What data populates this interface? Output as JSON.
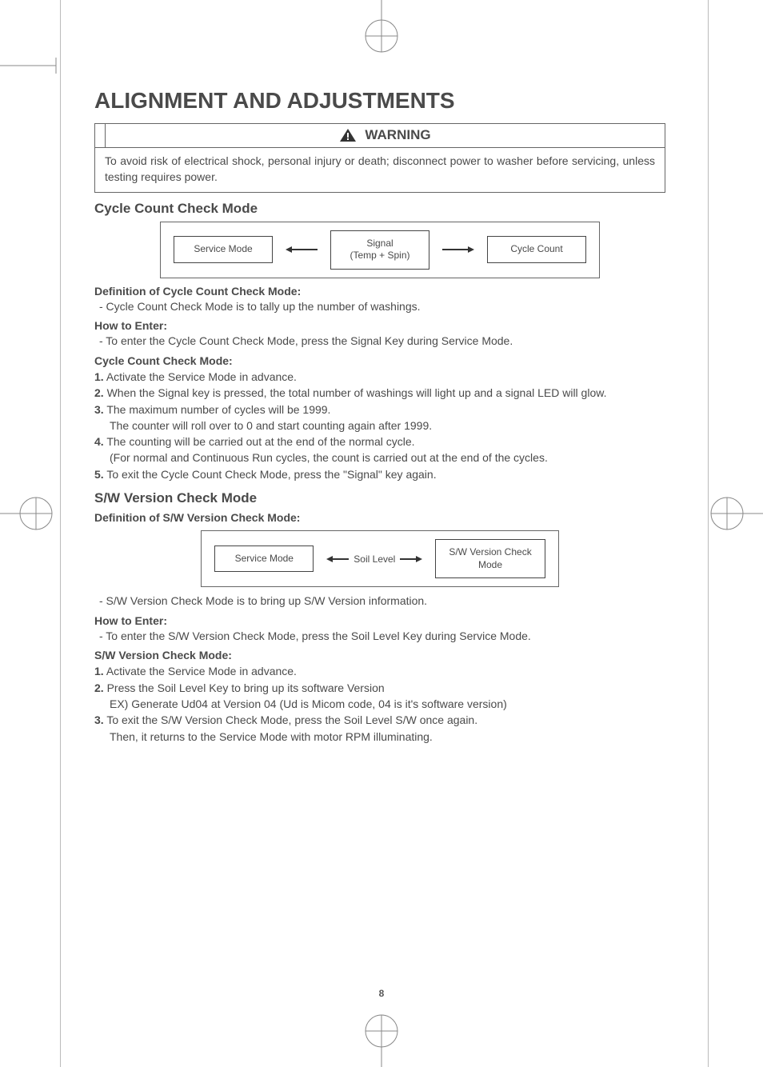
{
  "page_title": "ALIGNMENT AND ADJUSTMENTS",
  "warning": {
    "label": "WARNING",
    "text": "To avoid risk of electrical shock, personal injury or death; disconnect power to washer before servicing, unless testing requires power."
  },
  "section1": {
    "heading": "Cycle Count Check Mode",
    "diagram": {
      "left": "Service Mode",
      "mid_top": "Signal",
      "mid_bottom": "(Temp + Spin)",
      "right": "Cycle Count"
    },
    "def_label": "Definition of Cycle Count Check Mode:",
    "def_text": "-   Cycle Count Check Mode is to tally up the number of washings.",
    "how_label": "How to Enter:",
    "how_text": "-   To enter the Cycle Count Check Mode, press the Signal Key during Service Mode.",
    "steps_label": "Cycle Count Check Mode:",
    "steps": [
      "Activate the Service Mode in advance.",
      "When the Signal key is pressed, the total number of washings will light up and a signal LED will glow.",
      "The maximum number of cycles will be 1999.",
      "The counting will be carried out at the end of the normal cycle.",
      "To exit the Cycle Count Check Mode, press the \"Signal\" key again."
    ],
    "step3_sub": "The counter will roll over to 0 and start counting again after 1999.",
    "step4_sub": "(For normal and Continuous Run cycles, the count is carried out at the end of the cycles."
  },
  "section2": {
    "heading": "S/W Version Check Mode",
    "def_label": "Definition of S/W Version Check Mode:",
    "diagram": {
      "left": "Service Mode",
      "mid": "Soil Level",
      "right_top": "S/W Version Check",
      "right_bottom": "Mode"
    },
    "def_text": "-   S/W Version Check Mode is to bring up S/W Version information.",
    "how_label": "How to Enter:",
    "how_text": "-   To enter the S/W Version Check Mode, press the Soil Level Key during Service Mode.",
    "steps_label": "S/W Version Check Mode:",
    "steps": [
      "Activate the Service Mode in advance.",
      "Press the Soil Level Key to bring up its software Version",
      "To exit the S/W Version Check Mode, press the Soil Level S/W once again."
    ],
    "step2_sub": "EX) Generate Ud04 at Version 04 (Ud is Micom code, 04 is it's software  version)",
    "step3_sub": "Then, it returns to the Service Mode with motor RPM illuminating."
  },
  "page_number": "8"
}
